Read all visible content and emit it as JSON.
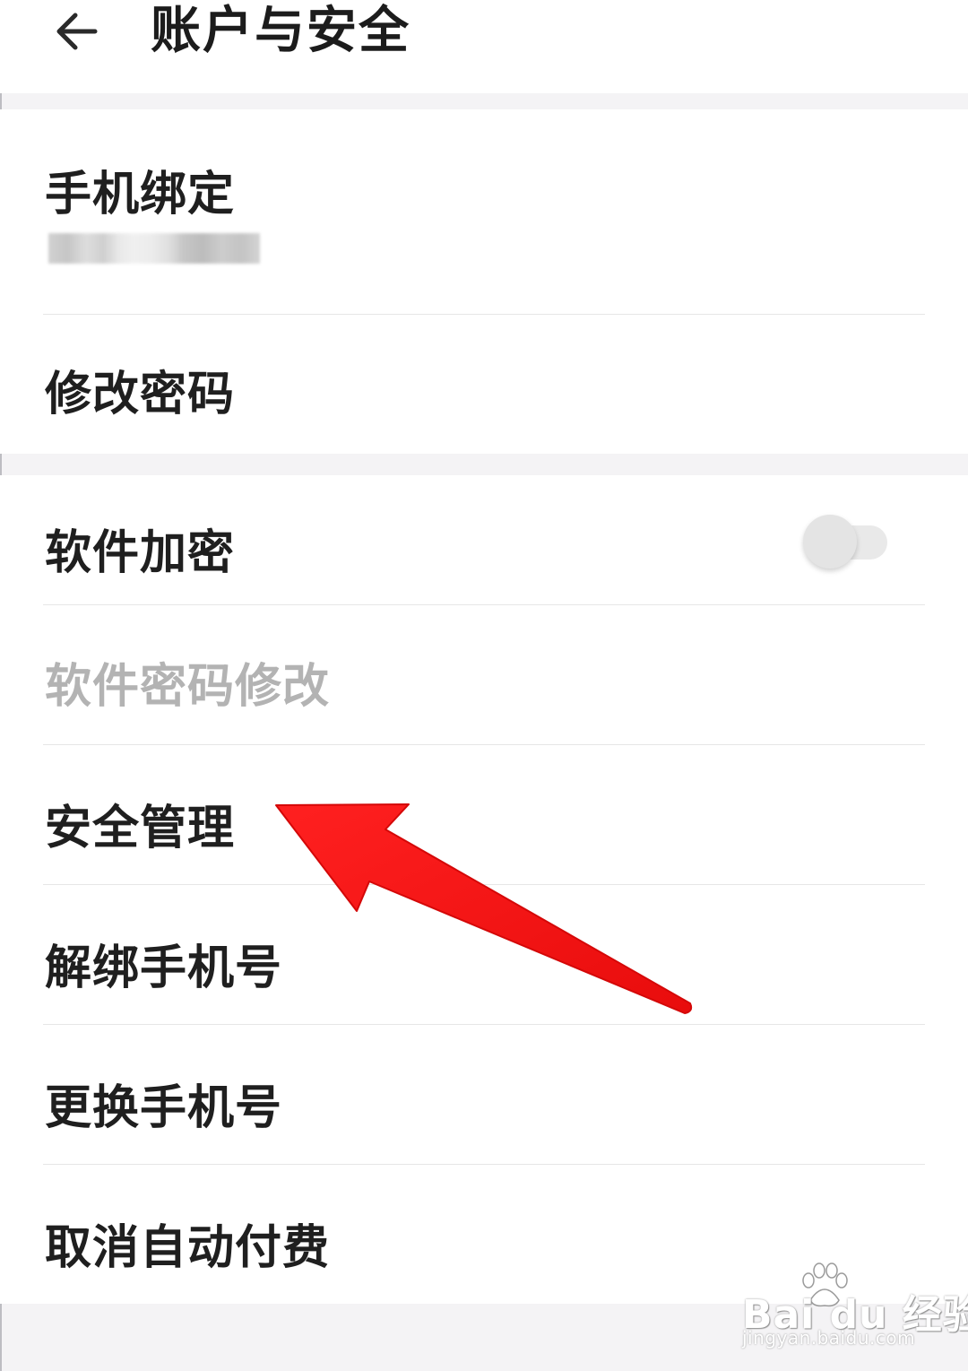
{
  "header": {
    "title": "账户与安全",
    "back_icon": "arrow-left-icon"
  },
  "account_section": {
    "phone_binding": {
      "label": "手机绑定",
      "value": "(masked)"
    },
    "change_password": {
      "label": "修改密码"
    }
  },
  "security_section": {
    "app_encryption": {
      "label": "软件加密",
      "toggle_on": false
    },
    "app_password_change": {
      "label": "软件密码修改",
      "disabled": true
    },
    "security_management": {
      "label": "安全管理"
    },
    "unbind_phone": {
      "label": "解绑手机号"
    },
    "change_phone": {
      "label": "更换手机号"
    },
    "cancel_auto_pay": {
      "label": "取消自动付费"
    }
  },
  "annotation": {
    "arrow_color": "#ee1111",
    "points_to": "security_management"
  },
  "watermark": {
    "logo": "Bai du 经验",
    "url": "jingyan.baidu.com"
  },
  "colors": {
    "background": "#f4f3f5",
    "card": "#ffffff",
    "text_primary": "#1f1f1f",
    "text_disabled": "#b3b3b3",
    "divider": "#e6e6e6"
  }
}
